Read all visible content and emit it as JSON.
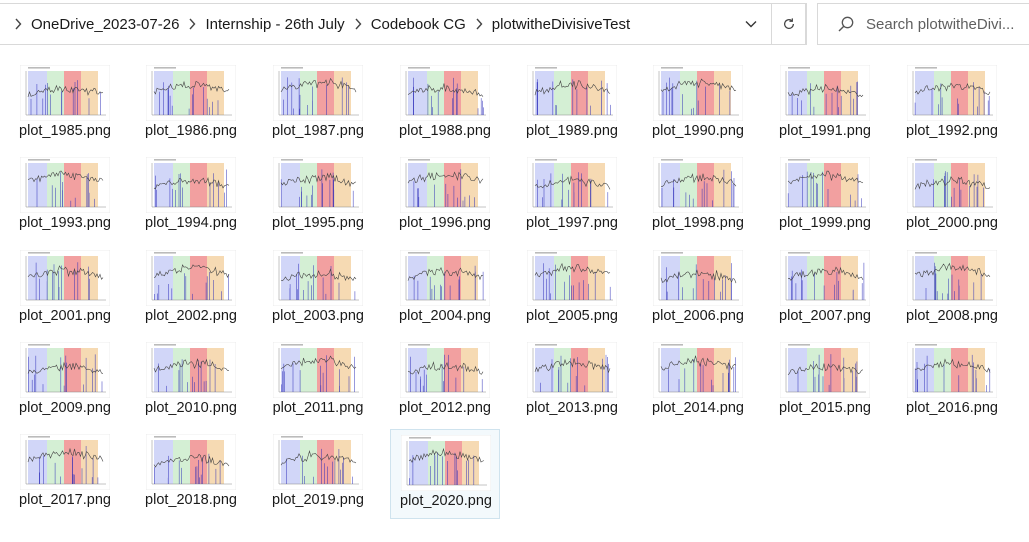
{
  "breadcrumb": {
    "items": [
      "OneDrive_2023-07-26",
      "Internship - 26th July",
      "Codebook CG",
      "plotwitheDivisiveTest"
    ]
  },
  "search": {
    "placeholder": "Search plotwitheDivi..."
  },
  "icons": {
    "chevron": "chevron-right-icon",
    "dropdown": "chevron-down-icon",
    "refresh": "refresh-icon",
    "search": "search-icon"
  },
  "thumbnail_colors": {
    "band_blue": "#c9cff7",
    "band_green": "#cdeccd",
    "band_red": "#f08f8f",
    "band_orange": "#f5d3a6",
    "line_dark": "#444444",
    "spike_blue": "#2929b8"
  },
  "files": [
    {
      "name": "plot_1985.png"
    },
    {
      "name": "plot_1986.png"
    },
    {
      "name": "plot_1987.png"
    },
    {
      "name": "plot_1988.png"
    },
    {
      "name": "plot_1989.png"
    },
    {
      "name": "plot_1990.png"
    },
    {
      "name": "plot_1991.png"
    },
    {
      "name": "plot_1992.png"
    },
    {
      "name": "plot_1993.png"
    },
    {
      "name": "plot_1994.png"
    },
    {
      "name": "plot_1995.png"
    },
    {
      "name": "plot_1996.png"
    },
    {
      "name": "plot_1997.png"
    },
    {
      "name": "plot_1998.png"
    },
    {
      "name": "plot_1999.png"
    },
    {
      "name": "plot_2000.png"
    },
    {
      "name": "plot_2001.png"
    },
    {
      "name": "plot_2002.png"
    },
    {
      "name": "plot_2003.png"
    },
    {
      "name": "plot_2004.png"
    },
    {
      "name": "plot_2005.png"
    },
    {
      "name": "plot_2006.png"
    },
    {
      "name": "plot_2007.png"
    },
    {
      "name": "plot_2008.png"
    },
    {
      "name": "plot_2009.png"
    },
    {
      "name": "plot_2010.png"
    },
    {
      "name": "plot_2011.png"
    },
    {
      "name": "plot_2012.png"
    },
    {
      "name": "plot_2013.png"
    },
    {
      "name": "plot_2014.png"
    },
    {
      "name": "plot_2015.png"
    },
    {
      "name": "plot_2016.png"
    },
    {
      "name": "plot_2017.png"
    },
    {
      "name": "plot_2018.png"
    },
    {
      "name": "plot_2019.png"
    },
    {
      "name": "plot_2020.png",
      "selected": true
    }
  ]
}
